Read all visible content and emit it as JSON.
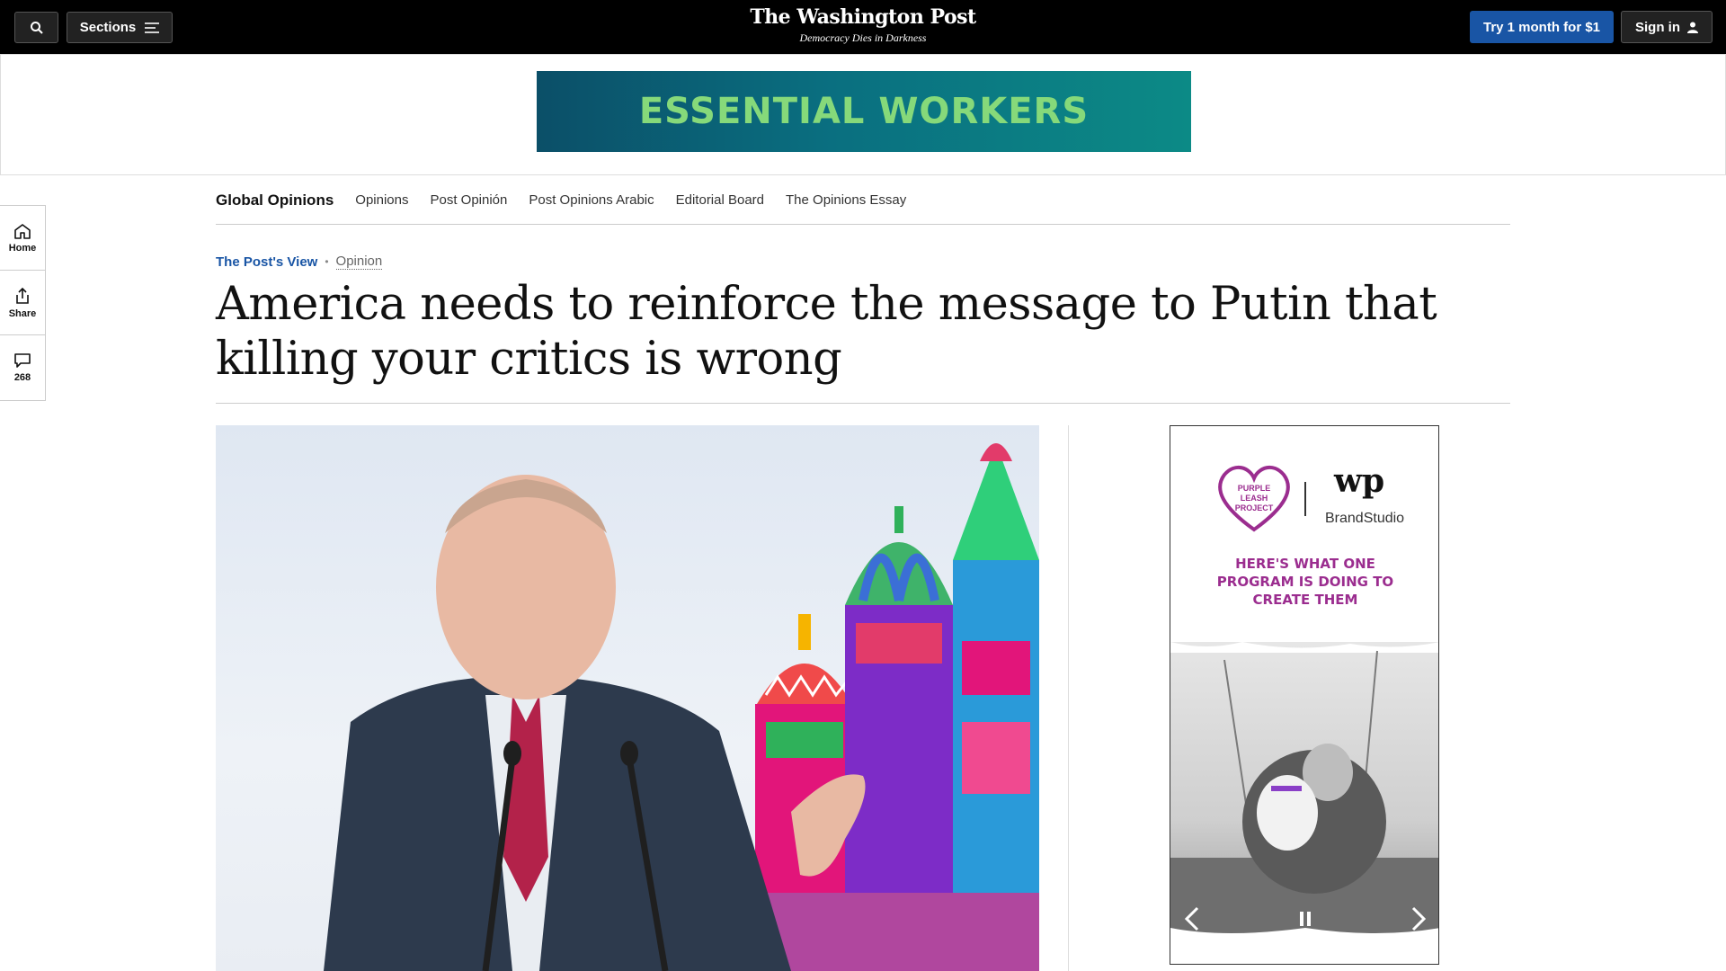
{
  "header": {
    "search_icon": "search-icon",
    "sections_label": "Sections",
    "logo_name": "The Washington Post",
    "logo_tagline": "Democracy Dies in Darkness",
    "try_label": "Try 1 month for $1",
    "signin_label": "Sign in",
    "accent_color": "#1955a5"
  },
  "top_ad": {
    "text": "ESSENTIAL WORKERS"
  },
  "section_nav": {
    "title": "Global Opinions",
    "items": [
      "Opinions",
      "Post Opinión",
      "Post Opinions Arabic",
      "Editorial Board",
      "The Opinions Essay"
    ]
  },
  "left_rail": {
    "home_label": "Home",
    "share_label": "Share",
    "comments_count": "268"
  },
  "article": {
    "kicker_section": "The Post's View",
    "kicker_label": "Opinion",
    "headline": "America needs to reinforce the message to Putin that killing your critics is wrong"
  },
  "side_ad": {
    "brand_left": "PURPLE LEASH PROJECT",
    "brand_right_mark": "wp",
    "brand_right": "BrandStudio",
    "copy": "HERE'S WHAT ONE PROGRAM IS DOING TO CREATE THEM"
  }
}
